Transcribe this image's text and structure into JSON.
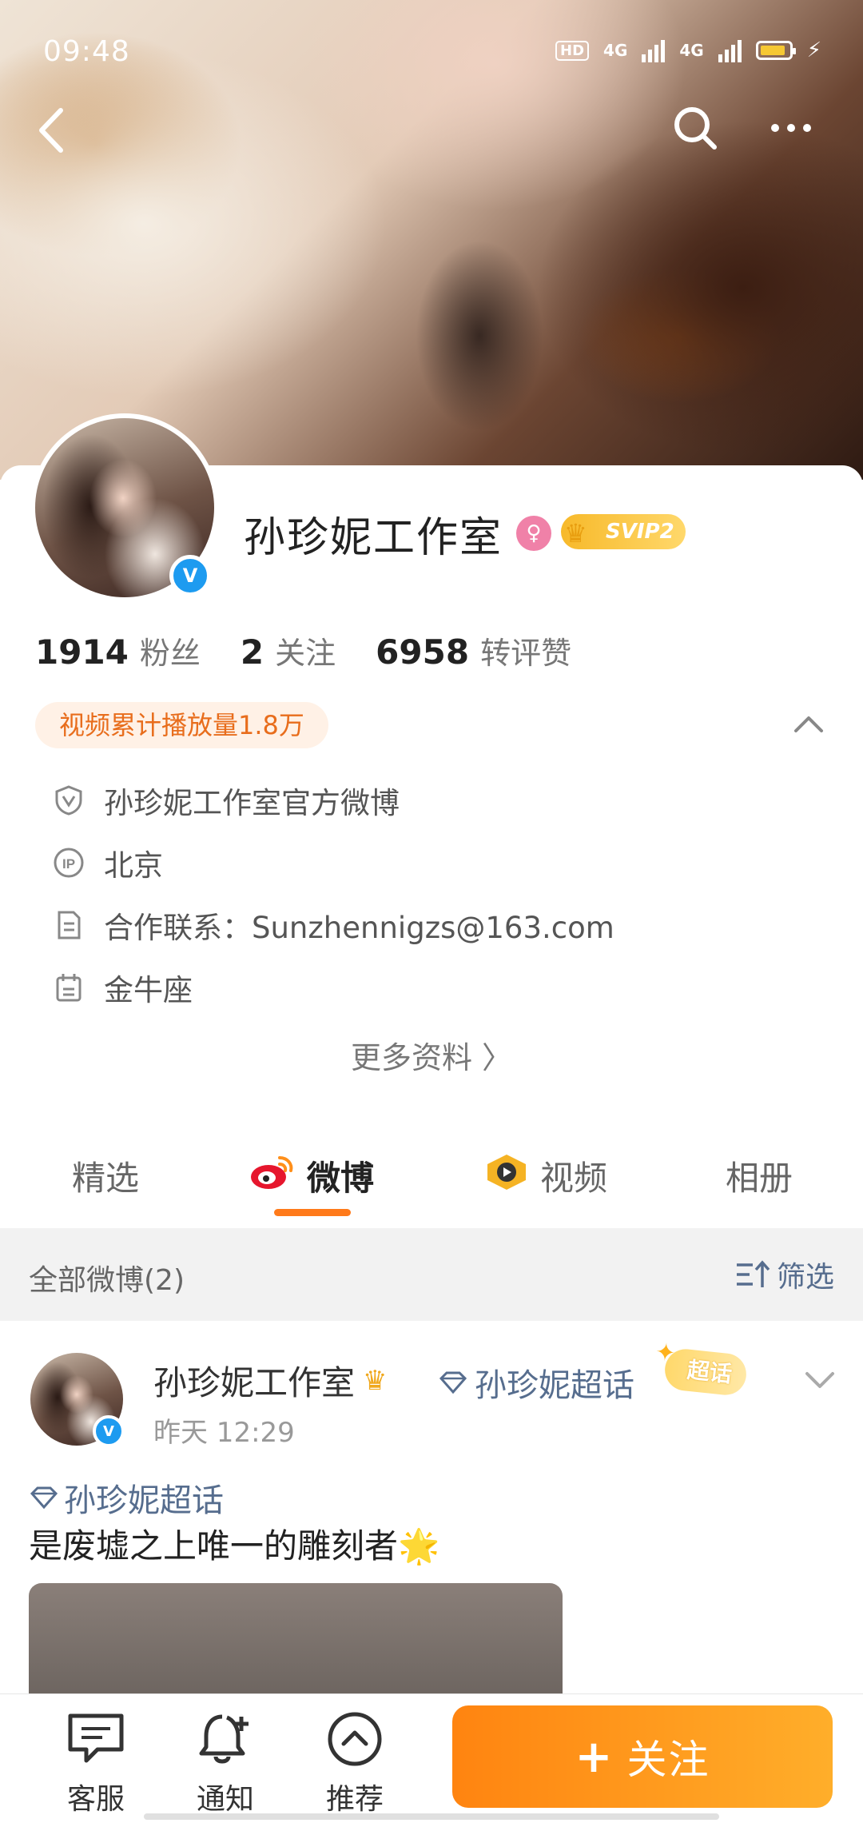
{
  "status_bar": {
    "time": "09:48",
    "hd": "HD",
    "network1": "4G",
    "network2": "4G"
  },
  "profile": {
    "name": "孙珍妮工作室",
    "vip_label": "SVIP2",
    "verified_mark": "V",
    "gender_symbol": "♀",
    "stats": [
      {
        "value": "1914",
        "label": "粉丝"
      },
      {
        "value": "2",
        "label": "关注"
      },
      {
        "value": "6958",
        "label": "转评赞"
      }
    ],
    "play_count": "视频累计播放量1.8万",
    "info": [
      {
        "icon": "verified-shield-icon",
        "text": "孙珍妮工作室官方微博"
      },
      {
        "icon": "ip-icon",
        "text": "北京"
      },
      {
        "icon": "document-icon",
        "text": "合作联系：Sunzhennigzs@163.com"
      },
      {
        "icon": "calendar-icon",
        "text": "金牛座"
      }
    ],
    "more_info": "更多资料 〉"
  },
  "tabs": [
    {
      "label": "精选",
      "icon": ""
    },
    {
      "label": "微博",
      "icon": "weibo-icon"
    },
    {
      "label": "视频",
      "icon": "video-icon"
    },
    {
      "label": "相册",
      "icon": ""
    }
  ],
  "active_tab": "微博",
  "filter": {
    "title": "全部微博(2)",
    "button": "筛选"
  },
  "post": {
    "author": "孙珍妮工作室",
    "topic_inline": "孙珍妮超话",
    "supertopic_badge": "超话",
    "time": "昨天 12:29",
    "tag": "孙珍妮超话",
    "text": "是废墟之上唯一的雕刻者",
    "text_emoji": "🌟"
  },
  "bottom_bar": {
    "items": [
      {
        "label": "客服",
        "icon": "chat-icon"
      },
      {
        "label": "通知",
        "icon": "bell-plus-icon"
      },
      {
        "label": "推荐",
        "icon": "chevron-up-circle-icon"
      }
    ],
    "follow_label": "关注",
    "follow_plus": "+"
  },
  "colors": {
    "accent": "#ff8410",
    "link": "#566d8e",
    "verified": "#1d9bf0",
    "badge_bg": "#fff1e6"
  }
}
